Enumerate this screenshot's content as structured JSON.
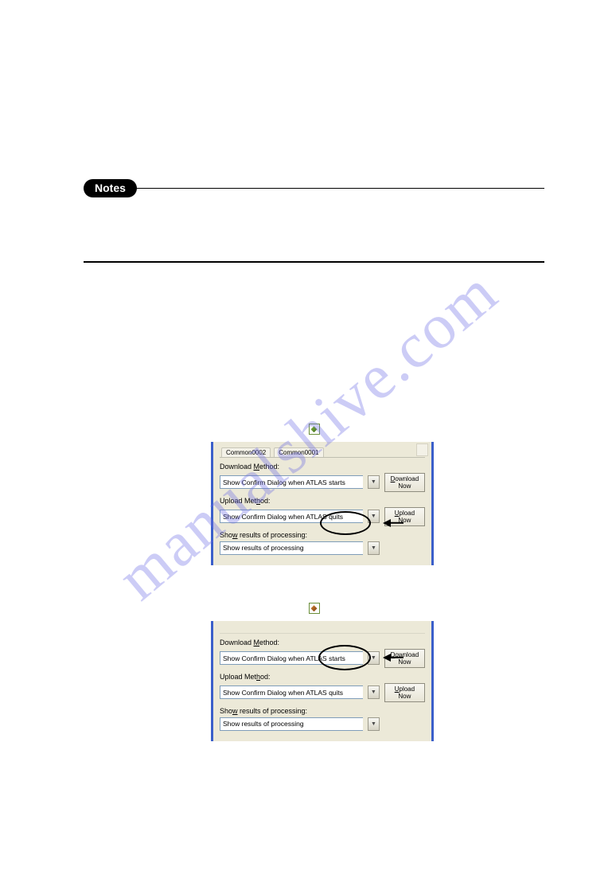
{
  "notes_label": "Notes",
  "watermark": "manualshive.com",
  "dialog1": {
    "tabs": {
      "t1": "Common0002",
      "t2": "Common0001"
    },
    "download_label_pre": "Download ",
    "download_label_ul": "M",
    "download_label_post": "ethod:",
    "download_select": "Show Confirm Dialog when ATLAS starts",
    "download_btn_ul": "D",
    "download_btn_l1_rest": "ownload",
    "download_btn_l2": "Now",
    "upload_label_pre": "Upload Met",
    "upload_label_ul": "h",
    "upload_label_post": "od:",
    "upload_select": "Show Confirm Dialog when ATLAS quits",
    "upload_btn_ul": "U",
    "upload_btn_l1_rest": "pload",
    "upload_btn_l2": "Now",
    "results_label_pre": "Sho",
    "results_label_ul": "w",
    "results_label_post": " results of processing:",
    "results_select": "Show results of processing"
  },
  "dialog2": {
    "download_label_pre": "Download ",
    "download_label_ul": "M",
    "download_label_post": "ethod:",
    "download_select": "Show Confirm Dialog when ATLAS starts",
    "download_btn_ul": "D",
    "download_btn_l1_rest": "ownload",
    "download_btn_l2": "Now",
    "upload_label_pre": "Upload Met",
    "upload_label_ul": "h",
    "upload_label_post": "od:",
    "upload_select": "Show Confirm Dialog when ATLAS quits",
    "upload_btn_ul": "U",
    "upload_btn_l1_rest": "pload",
    "upload_btn_l2": "Now",
    "results_label_pre": "Sho",
    "results_label_ul": "w",
    "results_label_post": " results of processing:",
    "results_select": "Show results of processing"
  }
}
